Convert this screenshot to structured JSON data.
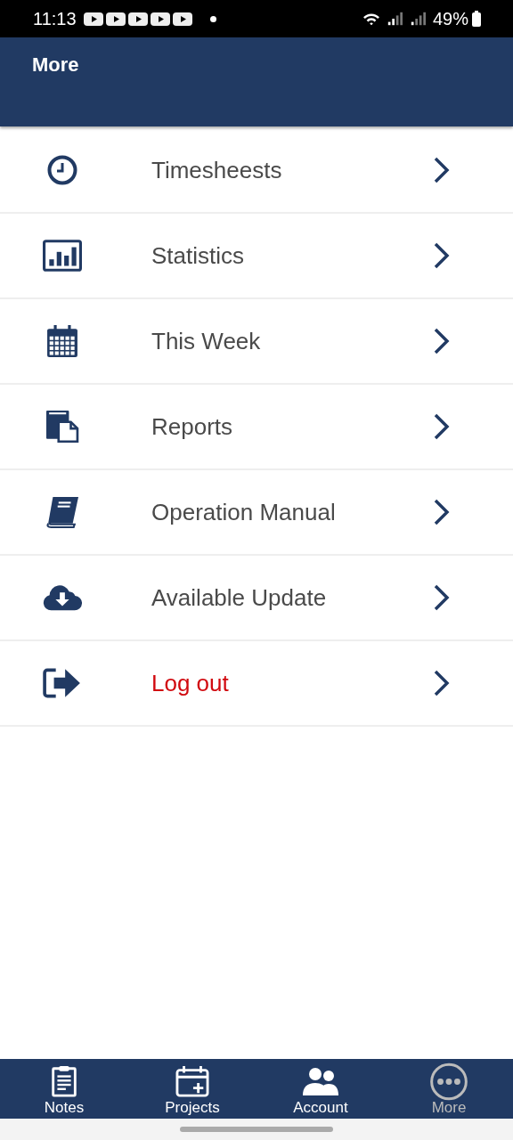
{
  "status_bar": {
    "time": "11:13",
    "battery": "49%"
  },
  "header": {
    "title": "More"
  },
  "menu": [
    {
      "kind": "clock",
      "label": "Timesheests",
      "destructive": false
    },
    {
      "kind": "chart",
      "label": "Statistics",
      "destructive": false
    },
    {
      "kind": "calendar",
      "label": "This Week",
      "destructive": false
    },
    {
      "kind": "documents",
      "label": "Reports",
      "destructive": false
    },
    {
      "kind": "book",
      "label": "Operation Manual",
      "destructive": false
    },
    {
      "kind": "download",
      "label": "Available Update",
      "destructive": false
    },
    {
      "kind": "logout",
      "label": "Log out",
      "destructive": true
    }
  ],
  "tabs": [
    {
      "kind": "notes",
      "label": "Notes",
      "selected": false
    },
    {
      "kind": "projects",
      "label": "Projects",
      "selected": false
    },
    {
      "kind": "account",
      "label": "Account",
      "selected": false
    },
    {
      "kind": "more",
      "label": "More",
      "selected": true
    }
  ]
}
